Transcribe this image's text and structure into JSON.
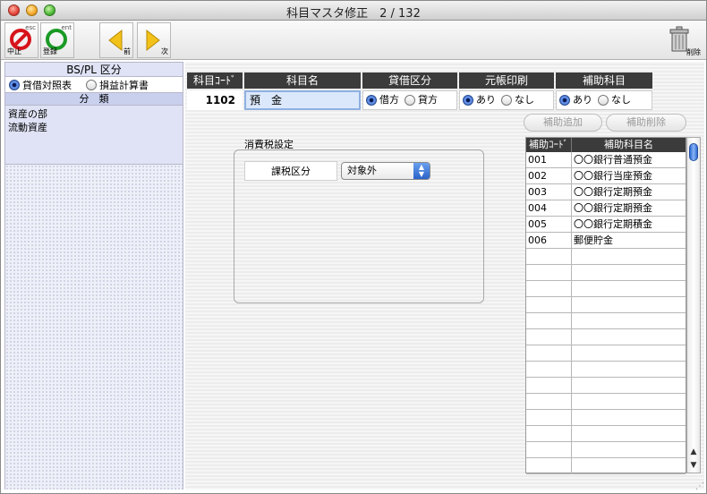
{
  "window": {
    "title": "科目マスタ修正　2 / 132"
  },
  "toolbar": {
    "cancel": {
      "key": "esc",
      "label": "中止"
    },
    "register": {
      "key": "ent",
      "label": "登録"
    },
    "prev": {
      "label": "前"
    },
    "next": {
      "label": "次"
    },
    "delete": {
      "label": "削除"
    }
  },
  "left": {
    "header": "BS/PL 区分",
    "radio_bs": "貸借対照表",
    "radio_pl": "損益計算書",
    "bunrui_header": "分　類",
    "items": [
      "資産の部",
      "流動資産"
    ]
  },
  "form": {
    "headers": {
      "code": "科目ｺｰﾄﾞ",
      "name": "科目名",
      "taishaku": "貸借区分",
      "ledger": "元帳印刷",
      "sub": "補助科目"
    },
    "values": {
      "code": "1102",
      "name": "預　金",
      "karikata": "借方",
      "kashikata": "貸方",
      "ledger_yes": "あり",
      "ledger_no": "なし",
      "sub_yes": "あり",
      "sub_no": "なし"
    },
    "buttons": {
      "add_sub": "補助追加",
      "del_sub": "補助削除"
    },
    "tax": {
      "section_label": "消費税設定",
      "kazei_label": "課税区分",
      "kazei_value": "対象外"
    }
  },
  "subtable": {
    "headers": {
      "code": "補助ｺｰﾄﾞ",
      "name": "補助科目名"
    },
    "rows": [
      {
        "code": "001",
        "name": "〇〇銀行普通預金"
      },
      {
        "code": "002",
        "name": "〇〇銀行当座預金"
      },
      {
        "code": "003",
        "name": "〇〇銀行定期預金"
      },
      {
        "code": "004",
        "name": "〇〇銀行定期預金"
      },
      {
        "code": "005",
        "name": "〇〇銀行定期積金"
      },
      {
        "code": "006",
        "name": "郵便貯金"
      },
      {
        "code": "",
        "name": ""
      },
      {
        "code": "",
        "name": ""
      },
      {
        "code": "",
        "name": ""
      },
      {
        "code": "",
        "name": ""
      },
      {
        "code": "",
        "name": ""
      },
      {
        "code": "",
        "name": ""
      },
      {
        "code": "",
        "name": ""
      },
      {
        "code": "",
        "name": ""
      },
      {
        "code": "",
        "name": ""
      },
      {
        "code": "",
        "name": ""
      },
      {
        "code": "",
        "name": ""
      },
      {
        "code": "",
        "name": ""
      },
      {
        "code": "",
        "name": ""
      },
      {
        "code": "",
        "name": ""
      }
    ]
  }
}
